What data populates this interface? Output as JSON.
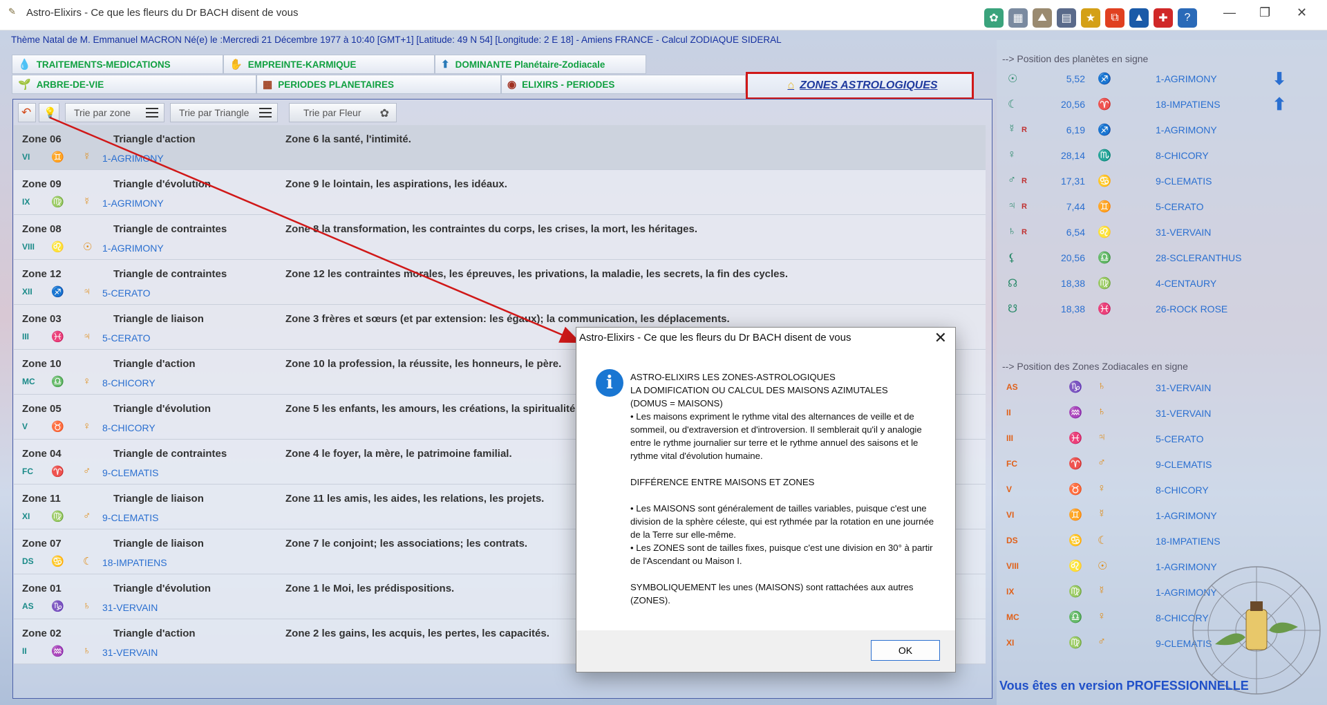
{
  "window": {
    "title": "Astro-Elixirs - Ce que les fleurs du Dr BACH disent de vous",
    "minimize": "—",
    "maximize": "❐",
    "close": "✕"
  },
  "toolbar_icons": [
    {
      "name": "wheel-icon",
      "glyph": "✿",
      "color": "#3aa37c"
    },
    {
      "name": "grid-icon",
      "glyph": "▦",
      "color": "#7a8aa0"
    },
    {
      "name": "landscape-icon",
      "glyph": "⛰",
      "color": "#9a8a70"
    },
    {
      "name": "document-icon",
      "glyph": "▤",
      "color": "#5a6a8a"
    },
    {
      "name": "folder-icon",
      "glyph": "★",
      "color": "#d4a017"
    },
    {
      "name": "copy-icon",
      "glyph": "⧉",
      "color": "#e04020"
    },
    {
      "name": "mountain-icon",
      "glyph": "▲",
      "color": "#1a5aa8"
    },
    {
      "name": "pin-icon",
      "glyph": "✚",
      "color": "#d02828"
    },
    {
      "name": "help-icon",
      "glyph": "?",
      "color": "#2a6ab8"
    }
  ],
  "info_line": "Thème Natal de M. Emmanuel   MACRON Né(e) le :Mercredi 21 Décembre 1977 à 10:40 [GMT+1] [Latitude: 49 N 54] [Longitude: 2 E 18] - Amiens FRANCE - Calcul ZODIAQUE SIDERAL",
  "tabs": {
    "traitements": "TRAITEMENTS-MEDICATIONS",
    "empreinte": "EMPREINTE-KARMIQUE",
    "dominante": "DOMINANTE Planétaire-Zodiacale",
    "arbre": "ARBRE-DE-VIE",
    "periodes": "PERIODES PLANETAIRES",
    "elixirs": "ELIXIRS - PERIODES",
    "zones": "ZONES ASTROLOGIQUES"
  },
  "tools": {
    "sort_zone": "Trie par zone",
    "sort_triangle": "Trie par Triangle",
    "sort_flower": "Trie par Fleur"
  },
  "zones": [
    {
      "zone": "Zone 06",
      "triangle": "Triangle d'action",
      "desc": "Zone 6 la santé, l'intimité.",
      "s1": "VI",
      "s2": "♊",
      "s3": "☿",
      "flower": "1-AGRIMONY"
    },
    {
      "zone": "Zone 09",
      "triangle": "Triangle d'évolution",
      "desc": "Zone 9 le lointain, les aspirations, les idéaux.",
      "s1": "IX",
      "s2": "♍",
      "s3": "☿",
      "flower": "1-AGRIMONY"
    },
    {
      "zone": "Zone 08",
      "triangle": "Triangle de contraintes",
      "desc": "Zone 8 la transformation, les contraintes du corps, les crises, la mort, les héritages.",
      "s1": "VIII",
      "s2": "♌",
      "s3": "☉",
      "flower": "1-AGRIMONY"
    },
    {
      "zone": "Zone 12",
      "triangle": "Triangle de contraintes",
      "desc": "Zone 12 les contraintes morales, les épreuves, les privations, la maladie, les secrets, la fin des cycles.",
      "s1": "XII",
      "s2": "♐",
      "s3": "♃",
      "flower": "5-CERATO"
    },
    {
      "zone": "Zone 03",
      "triangle": "Triangle de liaison",
      "desc": "Zone 3 frères et sœurs (et par extension: les égaux); la communication, les déplacements.",
      "s1": "III",
      "s2": "♓",
      "s3": "♃",
      "flower": "5-CERATO"
    },
    {
      "zone": "Zone 10",
      "triangle": "Triangle d'action",
      "desc": "Zone 10 la profession, la réussite, les honneurs, le père.",
      "s1": "MC",
      "s2": "♎",
      "s3": "♀",
      "flower": "8-CHICORY"
    },
    {
      "zone": "Zone 05",
      "triangle": "Triangle d'évolution",
      "desc": "Zone 5 les enfants, les amours, les créations, la spiritualité.",
      "s1": "V",
      "s2": "♉",
      "s3": "♀",
      "flower": "8-CHICORY"
    },
    {
      "zone": "Zone 04",
      "triangle": "Triangle de contraintes",
      "desc": "Zone 4 le foyer, la mère, le patrimoine familial.",
      "s1": "FC",
      "s2": "♈",
      "s3": "♂",
      "flower": "9-CLEMATIS"
    },
    {
      "zone": "Zone 11",
      "triangle": "Triangle de liaison",
      "desc": "Zone 11 les amis, les aides, les relations, les projets.",
      "s1": "XI",
      "s2": "♍",
      "s3": "♂",
      "flower": "9-CLEMATIS"
    },
    {
      "zone": "Zone 07",
      "triangle": "Triangle de liaison",
      "desc": "Zone 7 le conjoint; les associations; les contrats.",
      "s1": "DS",
      "s2": "♋",
      "s3": "☾",
      "flower": "18-IMPATIENS"
    },
    {
      "zone": "Zone 01",
      "triangle": "Triangle d'évolution",
      "desc": "Zone 1 le Moi, les prédispositions.",
      "s1": "AS",
      "s2": "♑",
      "s3": "♄",
      "flower": "31-VERVAIN"
    },
    {
      "zone": "Zone 02",
      "triangle": "Triangle d'action",
      "desc": "Zone 2 les gains, les acquis, les pertes, les capacités.",
      "s1": "II",
      "s2": "♒",
      "s3": "♄",
      "flower": "31-VERVAIN"
    }
  ],
  "planets_header": "--> Position des planètes en signe",
  "planets": [
    {
      "planet": "☉",
      "r": "",
      "deg": "5,52",
      "sign": "♐",
      "flower": "1-AGRIMONY",
      "arrow": "⬇"
    },
    {
      "planet": "☾",
      "r": "",
      "deg": "20,56",
      "sign": "♈",
      "flower": "18-IMPATIENS",
      "arrow": "⬆"
    },
    {
      "planet": "☿",
      "r": "R",
      "deg": "6,19",
      "sign": "♐",
      "flower": "1-AGRIMONY",
      "arrow": ""
    },
    {
      "planet": "♀",
      "r": "",
      "deg": "28,14",
      "sign": "♏",
      "flower": "8-CHICORY",
      "arrow": ""
    },
    {
      "planet": "♂",
      "r": "R",
      "deg": "17,31",
      "sign": "♋",
      "flower": "9-CLEMATIS",
      "arrow": ""
    },
    {
      "planet": "♃",
      "r": "R",
      "deg": "7,44",
      "sign": "♊",
      "flower": "5-CERATO",
      "arrow": ""
    },
    {
      "planet": "♄",
      "r": "R",
      "deg": "6,54",
      "sign": "♌",
      "flower": "31-VERVAIN",
      "arrow": ""
    },
    {
      "planet": "⚸",
      "r": "",
      "deg": "20,56",
      "sign": "♎",
      "flower": "28-SCLERANTHUS",
      "arrow": ""
    },
    {
      "planet": "☊",
      "r": "",
      "deg": "18,38",
      "sign": "♍",
      "flower": "4-CENTAURY",
      "arrow": ""
    },
    {
      "planet": "☋",
      "r": "",
      "deg": "18,38",
      "sign": "♓",
      "flower": "26-ROCK ROSE",
      "arrow": ""
    }
  ],
  "zones_header": "--> Position des Zones Zodiacales en signe",
  "zone_signs": [
    {
      "abbr": "AS",
      "sign": "♑",
      "planet": "♄",
      "flower": "31-VERVAIN"
    },
    {
      "abbr": "II",
      "sign": "♒",
      "planet": "♄",
      "flower": "31-VERVAIN"
    },
    {
      "abbr": "III",
      "sign": "♓",
      "planet": "♃",
      "flower": "5-CERATO"
    },
    {
      "abbr": "FC",
      "sign": "♈",
      "planet": "♂",
      "flower": "9-CLEMATIS"
    },
    {
      "abbr": "V",
      "sign": "♉",
      "planet": "♀",
      "flower": "8-CHICORY"
    },
    {
      "abbr": "VI",
      "sign": "♊",
      "planet": "☿",
      "flower": "1-AGRIMONY"
    },
    {
      "abbr": "DS",
      "sign": "♋",
      "planet": "☾",
      "flower": "18-IMPATIENS"
    },
    {
      "abbr": "VIII",
      "sign": "♌",
      "planet": "☉",
      "flower": "1-AGRIMONY"
    },
    {
      "abbr": "IX",
      "sign": "♍",
      "planet": "☿",
      "flower": "1-AGRIMONY"
    },
    {
      "abbr": "MC",
      "sign": "♎",
      "planet": "♀",
      "flower": "8-CHICORY"
    },
    {
      "abbr": "XI",
      "sign": "♍",
      "planet": "♂",
      "flower": "9-CLEMATIS"
    }
  ],
  "version_text": "Vous êtes en version PROFESSIONNELLE",
  "dialog": {
    "title": "Astro-Elixirs - Ce que les fleurs du Dr BACH disent de vous",
    "close": "✕",
    "icon": "i",
    "body": "ASTRO-ELIXIRS LES ZONES-ASTROLOGIQUES\nLA DOMIFICATION OU CALCUL DES MAISONS AZIMUTALES\n(DOMUS = MAISONS)\n• Les maisons expriment le rythme vital des alternances de veille et de sommeil, ou d'extraversion et d'introversion. Il semblerait qu'il y analogie entre le rythme journalier sur terre et le rythme annuel des saisons et le rythme vital d'évolution humaine.\n\nDIFFÉRENCE ENTRE MAISONS ET ZONES\n\n• Les MAISONS sont généralement de tailles variables, puisque c'est une division de la sphère céleste, qui est rythmée par la rotation en une journée de la Terre sur elle-même.\n• Les ZONES sont de tailles fixes, puisque c'est une division en 30° à partir de l'Ascendant ou Maison I.\n\nSYMBOLIQUEMENT les unes (MAISONS) sont rattachées aux autres (ZONES).",
    "ok": "OK"
  },
  "colors": {
    "accent_red": "#d01818",
    "tab_green": "#10a040",
    "link_blue": "#2a6fd0",
    "dialog_icon": "#1976d2"
  }
}
